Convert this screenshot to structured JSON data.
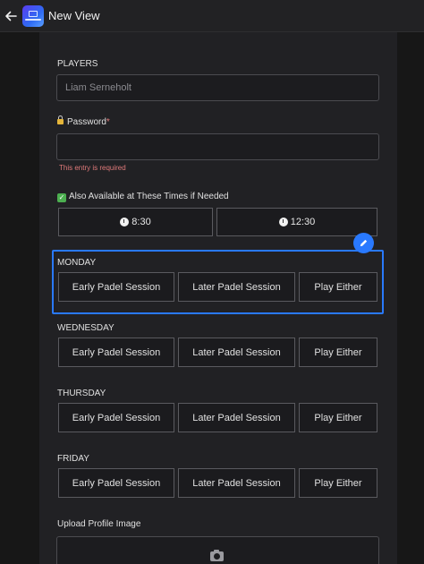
{
  "header": {
    "title": "New View"
  },
  "form": {
    "players": {
      "label": "PLAYERS",
      "placeholder": "Liam Serneholt"
    },
    "password": {
      "label": "Password",
      "required_mark": "*",
      "value": "",
      "error": "This entry is required"
    },
    "availability": {
      "label": "Also Available at These Times if Needed",
      "options": [
        "8:30",
        "12:30"
      ]
    },
    "days": [
      {
        "name": "MONDAY",
        "options": [
          "Early Padel Session",
          "Later Padel Session",
          "Play Either"
        ]
      },
      {
        "name": "WEDNESDAY",
        "options": [
          "Early Padel Session",
          "Later Padel Session",
          "Play Either"
        ]
      },
      {
        "name": "THURSDAY",
        "options": [
          "Early Padel Session",
          "Later Padel Session",
          "Play Either"
        ]
      },
      {
        "name": "FRIDAY",
        "options": [
          "Early Padel Session",
          "Later Padel Session",
          "Play Either"
        ]
      }
    ],
    "upload": {
      "label": "Upload Profile Image"
    }
  },
  "colors": {
    "accent": "#2979ff",
    "error": "#e07a7a",
    "panel": "#212124",
    "background": "#171717"
  },
  "icons": {
    "back": "arrow-left-icon",
    "edit": "pencil-icon",
    "camera": "camera-icon",
    "lock": "lock-icon",
    "check": "check-box-icon",
    "clock": "clock-icon"
  }
}
